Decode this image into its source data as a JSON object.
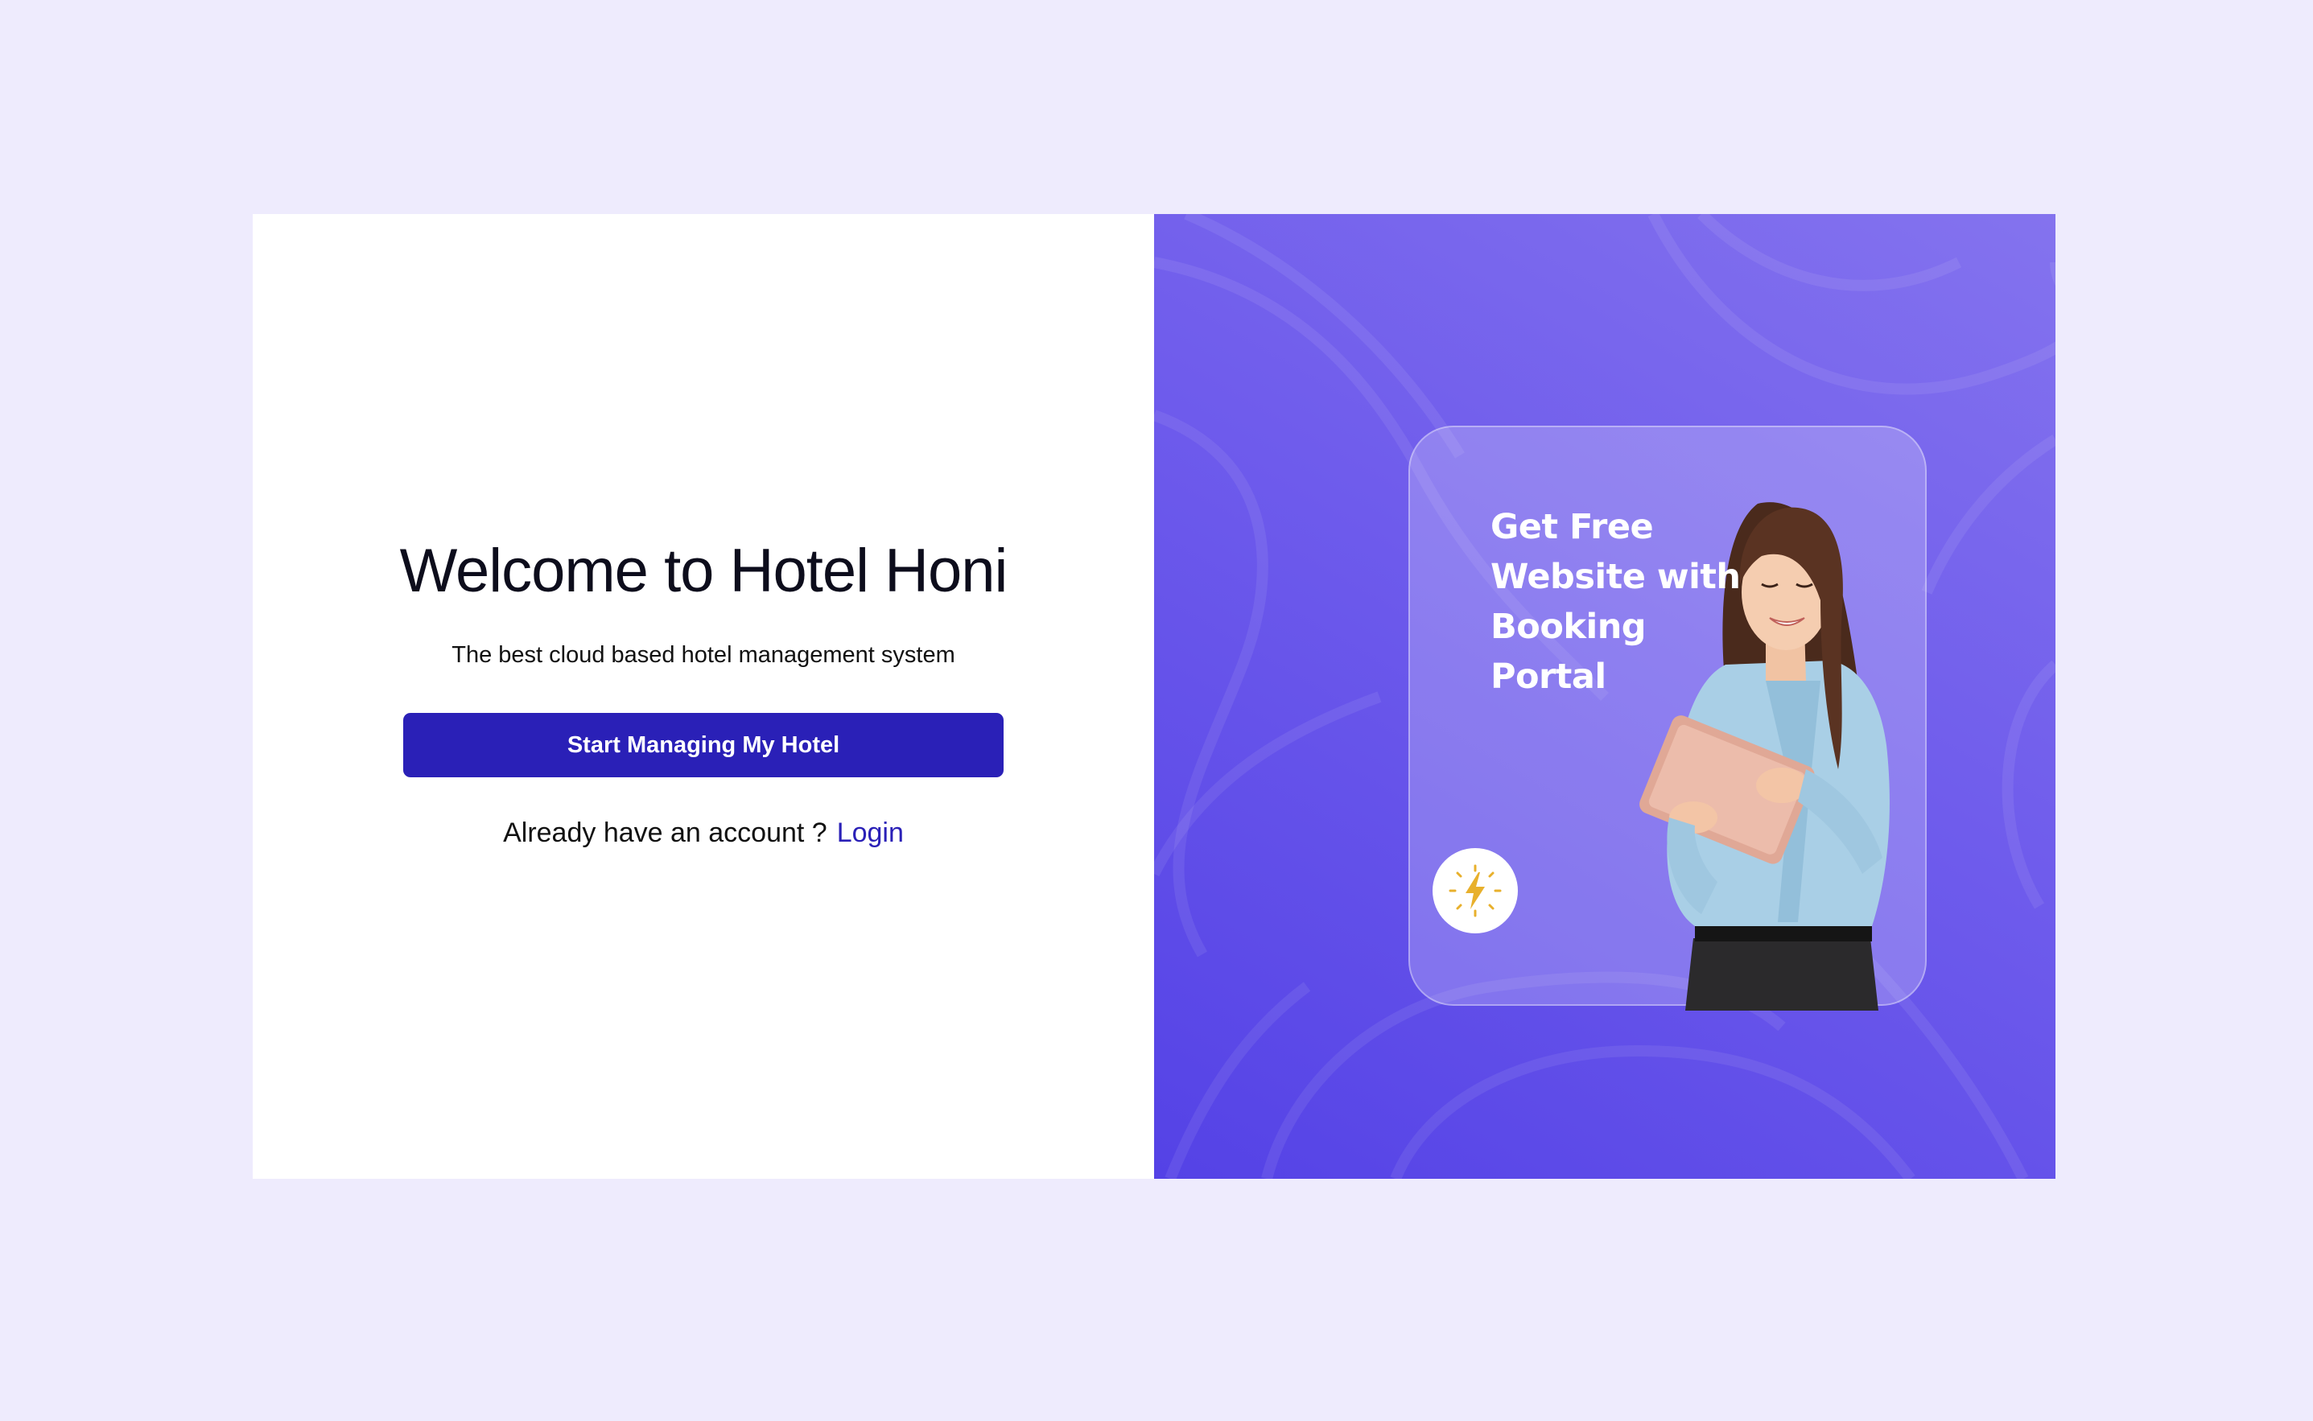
{
  "welcome": {
    "title": "Welcome to Hotel Honi",
    "subtitle": "The best cloud based hotel management system",
    "cta_label": "Start Managing My Hotel",
    "account_prompt": "Already have an account ?",
    "login_label": "Login"
  },
  "promo": {
    "headline_lines": [
      "Get Free",
      "Website with",
      "Booking",
      "Portal"
    ],
    "badge_icon": "lightning-bolt-icon",
    "illustration": "woman-with-tablet"
  },
  "colors": {
    "page_background": "#eeebfd",
    "accent": "#2a20b7",
    "promo_background": "#5f4de8",
    "bolt": "#e8b02c"
  }
}
